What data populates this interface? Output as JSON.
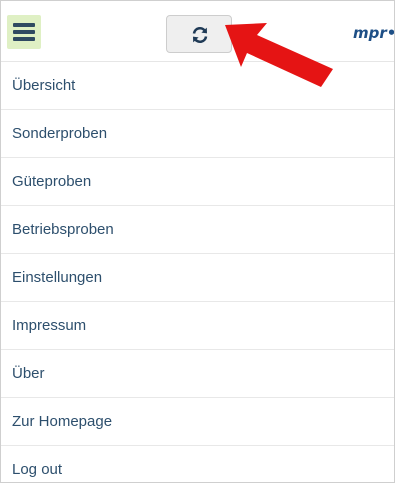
{
  "header": {
    "logo_text": "mpr",
    "menu_icon": "hamburger-menu-icon",
    "sync_icon": "sync-refresh-icon",
    "annotation_icon": "red-arrow-icon"
  },
  "menu": {
    "items": [
      {
        "label": "Übersicht"
      },
      {
        "label": "Sonderproben"
      },
      {
        "label": "Güteproben"
      },
      {
        "label": "Betriebsproben"
      },
      {
        "label": "Einstellungen"
      },
      {
        "label": "Impressum"
      },
      {
        "label": "Über"
      },
      {
        "label": "Zur Homepage"
      },
      {
        "label": "Log out"
      }
    ]
  },
  "colors": {
    "menu_text": "#2d4f6d",
    "hamburger_bg": "#dff0c4",
    "hamburger_bars": "#2f4a61",
    "logo": "#1e4f86",
    "arrow": "#e51414"
  }
}
